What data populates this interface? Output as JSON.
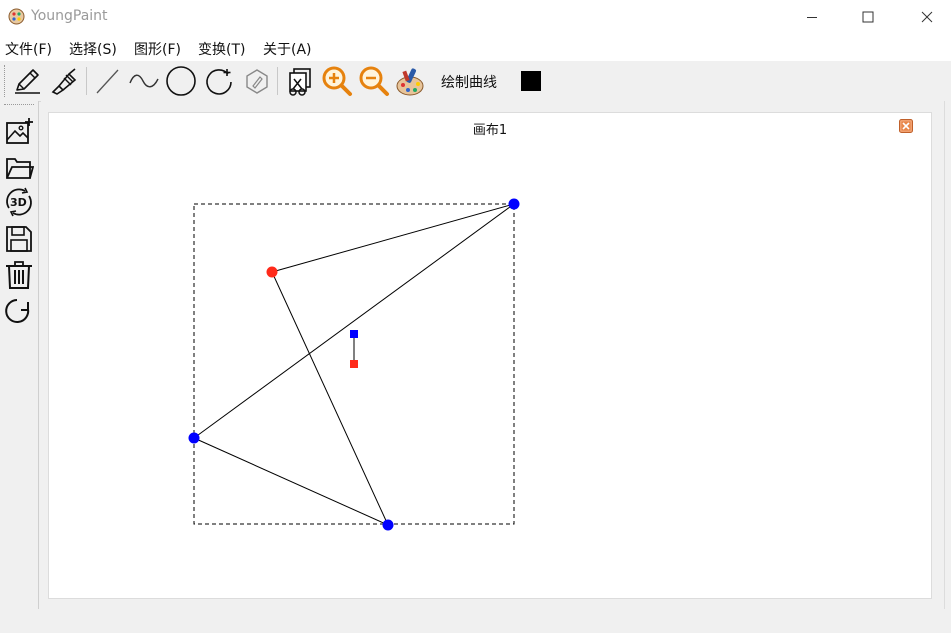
{
  "window": {
    "title": "YoungPaint"
  },
  "menu": [
    "文件(F)",
    "选择(S)",
    "图形(F)",
    "变换(T)",
    "关于(A)"
  ],
  "toolbar": {
    "tools": [
      "pencil-icon",
      "brush-icon",
      "line-icon",
      "curve-icon",
      "circle-icon",
      "rotate-circle-icon",
      "polygon-icon",
      "crop-icon",
      "zoom-in-icon",
      "zoom-out-icon",
      "palette-icon"
    ],
    "mode_label": "绘制曲线",
    "current_color": "#000000"
  },
  "sidebar": {
    "tools": [
      "new-image-icon",
      "open-folder-icon",
      "3d-rotate-icon",
      "save-icon",
      "trash-icon",
      "redo-icon"
    ]
  },
  "document": {
    "tab_title": "画布1"
  },
  "colors": {
    "control_point_blue": "#0000ff",
    "control_point_red": "#ff2a1a",
    "stroke": "#000000"
  }
}
